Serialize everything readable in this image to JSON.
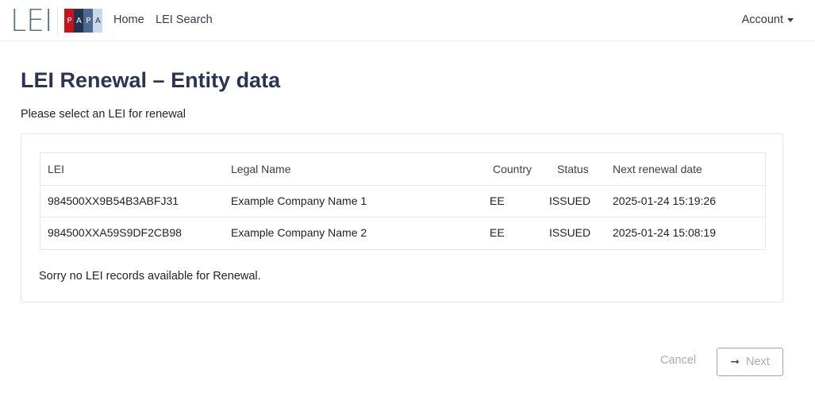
{
  "navbar": {
    "logo": {
      "text": "LEI",
      "papa_letters": [
        "P",
        "A",
        "P",
        "A"
      ],
      "colors": [
        "#c8131c",
        "#23324f",
        "#4c6a8f",
        "#c9d8ea"
      ]
    },
    "links": [
      {
        "label": "Home"
      },
      {
        "label": "LEI Search"
      }
    ],
    "account_label": "Account"
  },
  "page": {
    "title": "LEI Renewal – Entity data",
    "subtitle": "Please select an LEI for renewal"
  },
  "table": {
    "columns": [
      "LEI",
      "Legal Name",
      "Country",
      "Status",
      "Next renewal date"
    ],
    "rows": [
      {
        "lei": "984500XX9B54B3ABFJ31",
        "legal_name": "Example Company Name 1",
        "country": "EE",
        "status": "ISSUED",
        "next_renewal": "2025-01-24 15:19:26"
      },
      {
        "lei": "984500XXA59S9DF2CB98",
        "legal_name": "Example Company Name 2",
        "country": "EE",
        "status": "ISSUED",
        "next_renewal": "2025-01-24 15:08:19"
      }
    ]
  },
  "empty_message": "Sorry no LEI records available for Renewal.",
  "actions": {
    "cancel_label": "Cancel",
    "next_label": "Next",
    "next_icon": "arrow-right-icon"
  }
}
